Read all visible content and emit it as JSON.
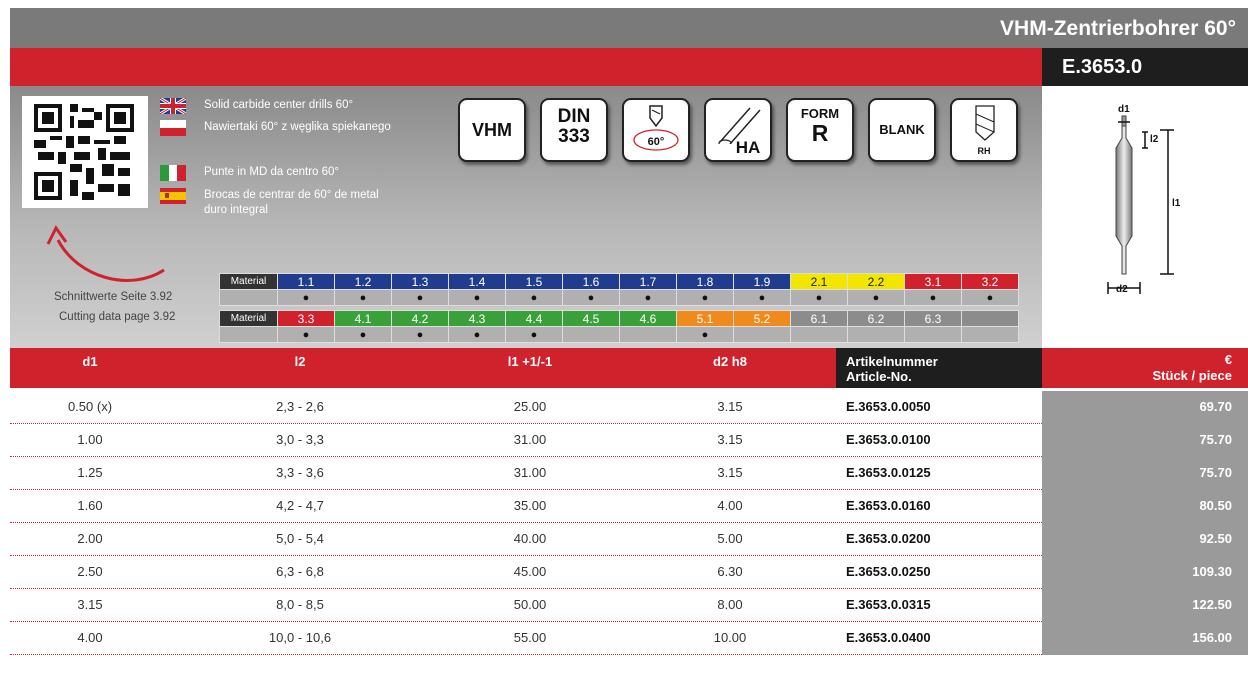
{
  "header": {
    "title": "VHM-Zentrierbohrer 60°",
    "code": "E.3653.0"
  },
  "languages": [
    {
      "flag": "gb-flag-icon",
      "text": "Solid carbide center drills 60°"
    },
    {
      "flag": "pl-flag-icon",
      "text": "Nawiertaki 60° z węglika spiekanego"
    },
    {
      "flag": "it-flag-icon",
      "text": "Punte in MD da centro 60°"
    },
    {
      "flag": "es-flag-icon",
      "text": "Brocas de centrar de 60° de metal duro integral"
    }
  ],
  "icons": [
    {
      "name": "vhm-icon",
      "line1": "VHM",
      "line2": ""
    },
    {
      "name": "din-333-icon",
      "line1": "DIN",
      "line2": "333"
    },
    {
      "name": "angle-60-icon",
      "line1": "60°",
      "line2": ""
    },
    {
      "name": "ha-shank-icon",
      "line1": "HA",
      "line2": ""
    },
    {
      "name": "form-r-icon",
      "line1": "FORM",
      "line2": "R"
    },
    {
      "name": "blank-icon",
      "line1": "BLANK",
      "line2": ""
    },
    {
      "name": "rh-icon",
      "line1": "RH",
      "line2": ""
    }
  ],
  "drawing_labels": {
    "d1": "d1",
    "l2": "l2",
    "l1": "l1",
    "d2": "d2"
  },
  "cutting": {
    "line1": "Schnittwerte Seite 3.92",
    "line2": "Cutting data page  3.92"
  },
  "materials": {
    "label": "Material",
    "row1": [
      {
        "code": "1.1",
        "color": "#1f3c8f",
        "dot": "●"
      },
      {
        "code": "1.2",
        "color": "#1f3c8f",
        "dot": "●"
      },
      {
        "code": "1.3",
        "color": "#1f3c8f",
        "dot": "●"
      },
      {
        "code": "1.4",
        "color": "#1f3c8f",
        "dot": "●"
      },
      {
        "code": "1.5",
        "color": "#1f3c8f",
        "dot": "●"
      },
      {
        "code": "1.6",
        "color": "#1f3c8f",
        "dot": "●"
      },
      {
        "code": "1.7",
        "color": "#1f3c8f",
        "dot": "●"
      },
      {
        "code": "1.8",
        "color": "#1f3c8f",
        "dot": "●"
      },
      {
        "code": "1.9",
        "color": "#1f3c8f",
        "dot": "●"
      },
      {
        "code": "2.1",
        "color": "#f2e600",
        "dot": "●"
      },
      {
        "code": "2.2",
        "color": "#f2e600",
        "dot": "●"
      },
      {
        "code": "3.1",
        "color": "#d0222c",
        "dot": "●"
      },
      {
        "code": "3.2",
        "color": "#d0222c",
        "dot": "●"
      }
    ],
    "row2": [
      {
        "code": "3.3",
        "color": "#d0222c",
        "dot": "●"
      },
      {
        "code": "4.1",
        "color": "#3aa13a",
        "dot": "●"
      },
      {
        "code": "4.2",
        "color": "#3aa13a",
        "dot": "●"
      },
      {
        "code": "4.3",
        "color": "#3aa13a",
        "dot": "●"
      },
      {
        "code": "4.4",
        "color": "#3aa13a",
        "dot": "●"
      },
      {
        "code": "4.5",
        "color": "#3aa13a",
        "dot": ""
      },
      {
        "code": "4.6",
        "color": "#3aa13a",
        "dot": ""
      },
      {
        "code": "5.1",
        "color": "#f08a1c",
        "dot": "●"
      },
      {
        "code": "5.2",
        "color": "#f08a1c",
        "dot": ""
      },
      {
        "code": "6.1",
        "color": "#8c8c8c",
        "dot": ""
      },
      {
        "code": "6.2",
        "color": "#8c8c8c",
        "dot": ""
      },
      {
        "code": "6.3",
        "color": "#8c8c8c",
        "dot": ""
      },
      {
        "code": "",
        "color": "#8c8c8c",
        "dot": ""
      }
    ]
  },
  "table": {
    "headers": {
      "d1": "d1",
      "l2": "l2",
      "l1": "l1 +1/-1",
      "d2": "d2 h8",
      "article_de": "Artikelnummer",
      "article_en": "Article-No.",
      "currency": "€",
      "unit": "Stück / piece"
    },
    "rows": [
      {
        "d1": "0.50 (x)",
        "l2": "2,3 - 2,6",
        "l1": "25.00",
        "d2": "3.15",
        "article": "E.3653.0.0050",
        "price": "69.70"
      },
      {
        "d1": "1.00",
        "l2": "3,0 - 3,3",
        "l1": "31.00",
        "d2": "3.15",
        "article": "E.3653.0.0100",
        "price": "75.70"
      },
      {
        "d1": "1.25",
        "l2": "3,3 - 3,6",
        "l1": "31.00",
        "d2": "3.15",
        "article": "E.3653.0.0125",
        "price": "75.70"
      },
      {
        "d1": "1.60",
        "l2": "4,2 - 4,7",
        "l1": "35.00",
        "d2": "4.00",
        "article": "E.3653.0.0160",
        "price": "80.50"
      },
      {
        "d1": "2.00",
        "l2": "5,0 - 5,4",
        "l1": "40.00",
        "d2": "5.00",
        "article": "E.3653.0.0200",
        "price": "92.50"
      },
      {
        "d1": "2.50",
        "l2": "6,3 - 6,8",
        "l1": "45.00",
        "d2": "6.30",
        "article": "E.3653.0.0250",
        "price": "109.30"
      },
      {
        "d1": "3.15",
        "l2": "8,0 - 8,5",
        "l1": "50.00",
        "d2": "8.00",
        "article": "E.3653.0.0315",
        "price": "122.50"
      },
      {
        "d1": "4.00",
        "l2": "10,0 - 10,6",
        "l1": "55.00",
        "d2": "10.00",
        "article": "E.3653.0.0400",
        "price": "156.00"
      }
    ]
  }
}
